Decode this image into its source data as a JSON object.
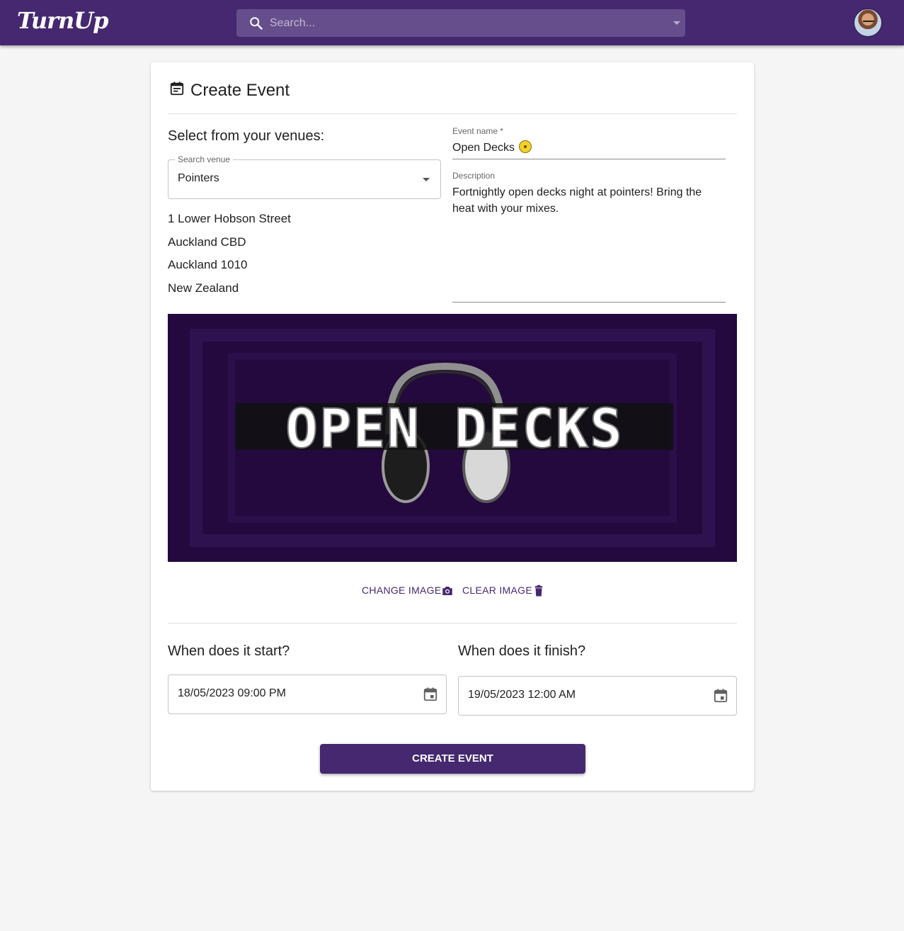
{
  "app": {
    "logo_text": "TurnUp",
    "accent_color": "#45286f"
  },
  "search": {
    "placeholder": "Search...",
    "icon": "search-icon"
  },
  "user": {
    "avatar_icon": "user-avatar"
  },
  "card": {
    "title": "Create Event",
    "title_icon": "calendar-icon",
    "venue_section": {
      "heading": "Select from your venues:",
      "search_label": "Search venue",
      "selected_venue": "Pointers",
      "address_lines": [
        "1 Lower Hobson Street",
        "Auckland CBD",
        "Auckland 1010",
        "New Zealand"
      ]
    },
    "event_name": {
      "label": "Event name *",
      "value": "Open Decks",
      "emoji_icon": "smiley-emoji-icon"
    },
    "description": {
      "label": "Description",
      "value": "Fortnightly open decks night at pointers! Bring the heat with your mixes."
    },
    "banner": {
      "text": "OPEN DECKS",
      "background_color": "#24093e"
    },
    "image_actions": {
      "change_label": "CHANGE IMAGE",
      "change_icon": "camera-icon",
      "clear_label": "CLEAR IMAGE",
      "clear_icon": "trash-icon"
    },
    "start": {
      "heading": "When does it start?",
      "value": "18/05/2023 09:00 PM",
      "icon": "calendar-icon"
    },
    "finish": {
      "heading": "When does it finish?",
      "value": "19/05/2023 12:00 AM",
      "icon": "calendar-icon"
    },
    "submit_label": "CREATE EVENT"
  }
}
